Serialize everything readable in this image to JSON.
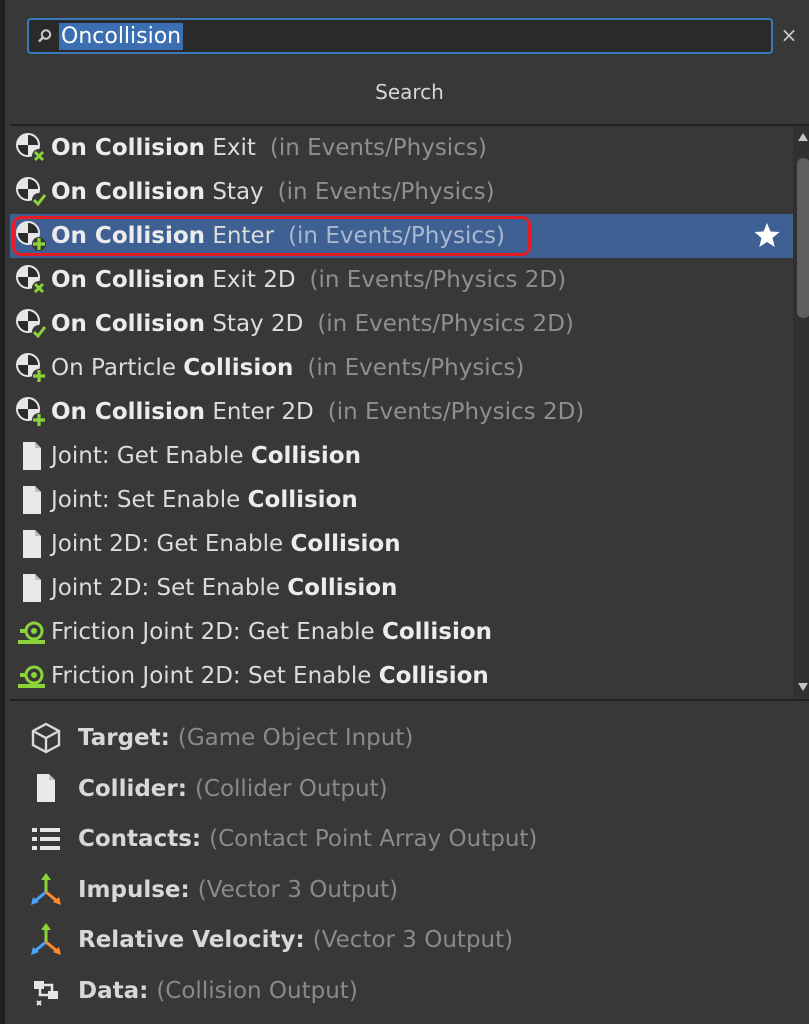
{
  "search": {
    "value": "Oncollision",
    "clear": "×",
    "title": "Search"
  },
  "results": [
    {
      "bold": "On Collision",
      "rest": " Exit",
      "category": "(in Events/Physics)",
      "icon": "event-exit-icon"
    },
    {
      "bold": "On Collision",
      "rest": " Stay",
      "category": "(in Events/Physics)",
      "icon": "event-stay-icon"
    },
    {
      "bold": "On Collision",
      "rest": " Enter",
      "category": "(in Events/Physics)",
      "icon": "event-enter-icon",
      "selected": true
    },
    {
      "bold": "On Collision",
      "rest": " Exit 2D",
      "category": "(in Events/Physics 2D)",
      "icon": "event-exit-icon"
    },
    {
      "bold": "On Collision",
      "rest": " Stay 2D",
      "category": "(in Events/Physics 2D)",
      "icon": "event-stay-icon"
    },
    {
      "pre": "On Particle ",
      "bold": "Collision",
      "rest": "",
      "category": "(in Events/Physics)",
      "icon": "event-enter-icon"
    },
    {
      "bold": "On Collision",
      "rest": " Enter 2D",
      "category": "(in Events/Physics 2D)",
      "icon": "event-enter-icon"
    },
    {
      "pre": "Joint: Get Enable ",
      "bold": "Collision",
      "rest": "",
      "category": "",
      "icon": "document-icon"
    },
    {
      "pre": "Joint: Set Enable ",
      "bold": "Collision",
      "rest": "",
      "category": "",
      "icon": "document-icon"
    },
    {
      "pre": "Joint 2D: Get Enable ",
      "bold": "Collision",
      "rest": "",
      "category": "",
      "icon": "document-icon"
    },
    {
      "pre": "Joint 2D: Set Enable ",
      "bold": "Collision",
      "rest": "",
      "category": "",
      "icon": "document-icon"
    },
    {
      "pre": "Friction Joint 2D: Get Enable ",
      "bold": "Collision",
      "rest": "",
      "category": "",
      "icon": "friction-joint-icon"
    },
    {
      "pre": "Friction Joint 2D: Set Enable ",
      "bold": "Collision",
      "rest": "",
      "category": "",
      "icon": "friction-joint-icon"
    }
  ],
  "ports": [
    {
      "name": "Target:",
      "type": "(Game Object Input)",
      "icon": "cube-icon"
    },
    {
      "name": "Collider:",
      "type": "(Collider Output)",
      "icon": "document-icon"
    },
    {
      "name": "Contacts:",
      "type": "(Contact Point Array Output)",
      "icon": "list-icon"
    },
    {
      "name": "Impulse:",
      "type": "(Vector 3 Output)",
      "icon": "vector3-icon"
    },
    {
      "name": "Relative Velocity:",
      "type": "(Vector 3 Output)",
      "icon": "vector3-icon"
    },
    {
      "name": "Data:",
      "type": "(Collision Output)",
      "icon": "collision-data-icon"
    }
  ],
  "colors": {
    "selection": "#3e6092",
    "highlight": "#e51c23",
    "accent_green": "#8ad43a"
  }
}
